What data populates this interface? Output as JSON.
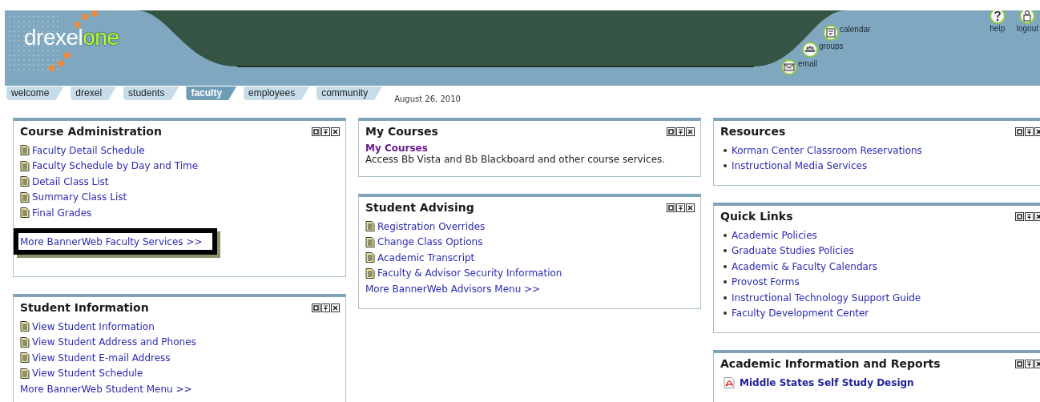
{
  "header": {
    "logo": [
      "drexel",
      "one"
    ],
    "shortcuts": [
      {
        "label": "calendar",
        "kind": "calendar"
      },
      {
        "label": "groups",
        "kind": "groups"
      },
      {
        "label": "email",
        "kind": "email"
      }
    ],
    "utility": [
      {
        "label": "help",
        "kind": "help"
      },
      {
        "label": "logout",
        "kind": "logout"
      }
    ]
  },
  "tabs": [
    {
      "label": "welcome",
      "selected": false
    },
    {
      "label": "drexel",
      "selected": false
    },
    {
      "label": "students",
      "selected": false
    },
    {
      "label": "faculty",
      "selected": true
    },
    {
      "label": "employees",
      "selected": false
    },
    {
      "label": "community",
      "selected": false
    }
  ],
  "date": "August 26, 2010",
  "columns": [
    [
      {
        "title": "Course Administration",
        "items": [
          {
            "kind": "doc",
            "label": "Faculty Detail Schedule"
          },
          {
            "kind": "doc",
            "label": "Faculty Schedule by Day and Time"
          },
          {
            "kind": "doc",
            "label": "Detail Class List"
          },
          {
            "kind": "doc",
            "label": "Summary Class List"
          },
          {
            "kind": "doc",
            "label": "Final Grades"
          }
        ],
        "overlay": {
          "label": "More BannerWeb Faculty Services >>"
        }
      },
      {
        "title": "Student Information",
        "items": [
          {
            "kind": "doc",
            "label": "View Student Information"
          },
          {
            "kind": "doc",
            "label": "View Student Address and Phones"
          },
          {
            "kind": "doc",
            "label": "View Student E-mail Address"
          },
          {
            "kind": "doc",
            "label": "View Student Schedule"
          },
          {
            "kind": "more",
            "label": "More BannerWeb Student Menu >>"
          }
        ]
      }
    ],
    [
      {
        "title": "My Courses",
        "items": [
          {
            "kind": "heading",
            "label": "My Courses"
          },
          {
            "kind": "text",
            "label": "Access Bb Vista and Bb Blackboard and other course services."
          }
        ]
      },
      {
        "title": "Student Advising",
        "items": [
          {
            "kind": "doc",
            "label": "Registration Overrides"
          },
          {
            "kind": "doc",
            "label": "Change Class Options"
          },
          {
            "kind": "doc",
            "label": "Academic Transcript"
          },
          {
            "kind": "doc",
            "label": "Faculty & Advisor Security Information"
          },
          {
            "kind": "more",
            "label": "More BannerWeb Advisors Menu >>"
          }
        ]
      }
    ],
    [
      {
        "title": "Resources",
        "items": [
          {
            "kind": "bullet",
            "label": "Korman Center Classroom Reservations"
          },
          {
            "kind": "bullet",
            "label": "Instructional Media Services"
          }
        ]
      },
      {
        "title": "Quick Links",
        "items": [
          {
            "kind": "bullet",
            "label": "Academic Policies"
          },
          {
            "kind": "bullet",
            "label": "Graduate Studies Policies"
          },
          {
            "kind": "bullet",
            "label": "Academic & Faculty Calendars"
          },
          {
            "kind": "bullet",
            "label": "Provost Forms"
          },
          {
            "kind": "bullet",
            "label": "Instructional Technology Support Guide"
          },
          {
            "kind": "bullet",
            "label": "Faculty Development Center"
          }
        ]
      },
      {
        "title": "Academic Information and Reports",
        "items": [
          {
            "kind": "pdf",
            "label": "Middle States Self Study Design"
          }
        ]
      }
    ]
  ]
}
